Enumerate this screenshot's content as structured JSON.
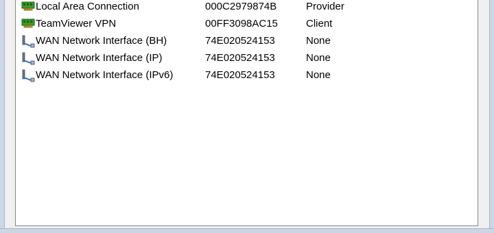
{
  "adapters": [
    {
      "name": "Local Area Connection",
      "mac": "000C2979874B",
      "type": "Provider",
      "icon": "network-card-icon"
    },
    {
      "name": "TeamViewer VPN",
      "mac": "00FF3098AC15",
      "type": "Client",
      "icon": "network-card-icon"
    },
    {
      "name": "WAN Network Interface (BH)",
      "mac": "74E020524153",
      "type": "None",
      "icon": "wan-cable-icon"
    },
    {
      "name": "WAN Network Interface (IP)",
      "mac": "74E020524153",
      "type": "None",
      "icon": "wan-cable-icon"
    },
    {
      "name": "WAN Network Interface (IPv6)",
      "mac": "74E020524153",
      "type": "None",
      "icon": "wan-cable-icon"
    }
  ],
  "colors": {
    "list_background": "#ffffff",
    "window_frame": "#ccd6e4",
    "card_green": "#3a9a2a"
  }
}
